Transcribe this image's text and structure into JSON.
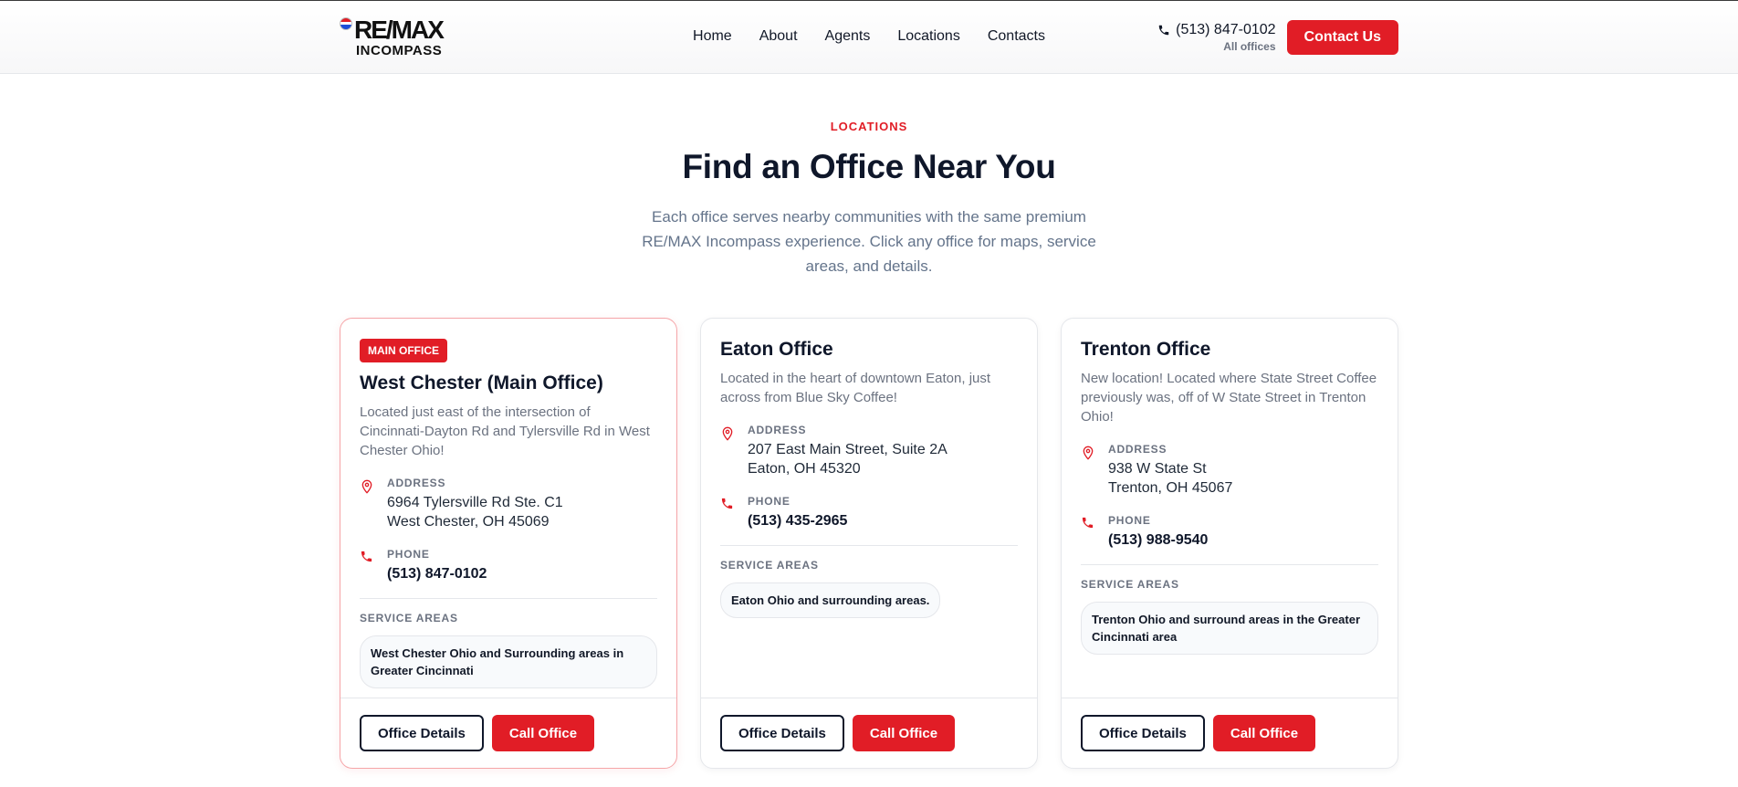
{
  "header": {
    "logo_line1": "RE/MAX",
    "logo_line2": "INCOMPASS",
    "nav": [
      "Home",
      "About",
      "Agents",
      "Locations",
      "Contacts"
    ],
    "phone": "(513) 847-0102",
    "phone_sub": "All offices",
    "cta": "Contact Us"
  },
  "hero": {
    "eyebrow": "LOCATIONS",
    "title": "Find an Office Near You",
    "subtitle": "Each office serves nearby communities with the same premium RE/MAX Incompass experience. Click any office for maps, service areas, and details."
  },
  "labels": {
    "address": "ADDRESS",
    "phone": "PHONE",
    "service_areas": "SERVICE AREAS",
    "details_btn": "Office Details",
    "call_btn": "Call Office"
  },
  "offices": [
    {
      "badge": "MAIN OFFICE",
      "name": "West Chester (Main Office)",
      "description": "Located just east of the intersection of Cincinnati-Dayton Rd and Tylersville Rd in West Chester Ohio!",
      "address1": "6964 Tylersville Rd Ste. C1",
      "address2": "West Chester, OH 45069",
      "phone": "(513) 847-0102",
      "service_area": "West Chester Ohio and Surrounding areas in Greater Cincinnati"
    },
    {
      "name": "Eaton Office",
      "description": "Located in the heart of downtown Eaton, just across from Blue Sky Coffee!",
      "address1": "207 East Main Street, Suite 2A",
      "address2": "Eaton, OH 45320",
      "phone": "(513) 435-2965",
      "service_area": "Eaton Ohio and surrounding areas."
    },
    {
      "name": "Trenton Office",
      "description": "New location! Located where State Street Coffee previously was, off of W State Street in Trenton Ohio!",
      "address1": "938 W State St",
      "address2": "Trenton, OH 45067",
      "phone": "(513) 988-9540",
      "service_area": "Trenton Ohio and surround areas in the Greater Cincinnati area"
    }
  ],
  "colors": {
    "accent": "#e11d26",
    "text_dark": "#0f172a",
    "text_muted": "#6b7280"
  }
}
